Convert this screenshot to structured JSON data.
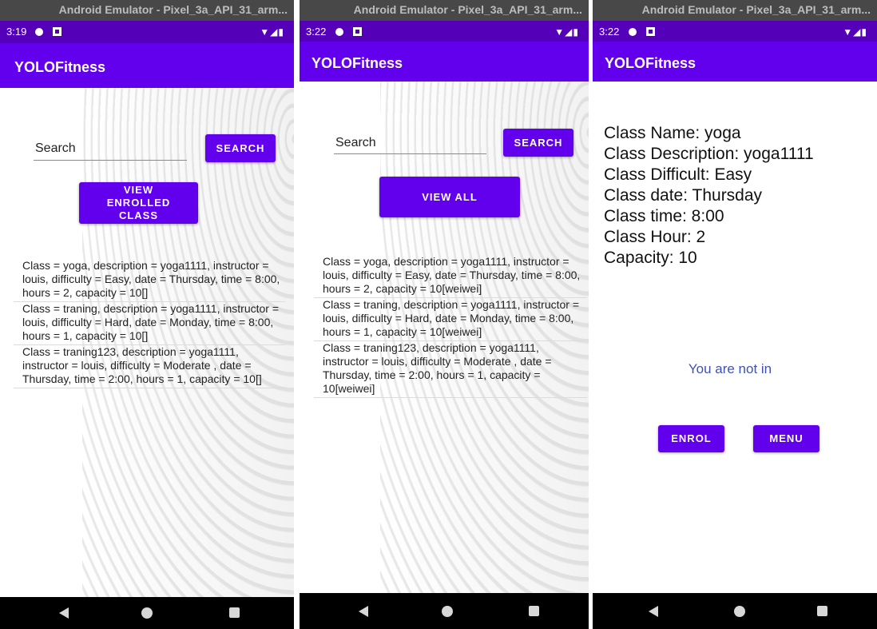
{
  "emulator_title": "Android Emulator - Pixel_3a_API_31_arm...",
  "app_title": "YOLOFitness",
  "screens": {
    "s1": {
      "time": "3:19",
      "search_text": "Search",
      "search_button": "SEARCH",
      "view_button": "VIEW ENROLLED CLASS",
      "items": [
        "Class = yoga, description = yoga1111, instructor = louis, difficulty = Easy, date = Thursday, time = 8:00, hours = 2, capacity = 10[]",
        "Class = traning, description = yoga1111, instructor = louis, difficulty = Hard, date = Monday, time = 8:00, hours = 1, capacity = 10[]",
        "Class = traning123, description = yoga1111, instructor = louis, difficulty = Moderate , date = Thursday, time = 2:00, hours = 1, capacity = 10[]"
      ]
    },
    "s2": {
      "time": "3:22",
      "search_text": "Search",
      "search_button": "SEARCH",
      "view_button": "VIEW ALL",
      "items": [
        "Class = yoga, description = yoga1111, instructor = louis, difficulty = Easy, date = Thursday, time = 8:00, hours = 2, capacity = 10[weiwei]",
        "Class = traning, description = yoga1111, instructor = louis, difficulty = Hard, date = Monday, time = 8:00, hours = 1, capacity = 10[weiwei]",
        "Class = traning123, description = yoga1111, instructor = louis, difficulty = Moderate , date = Thursday, time = 2:00, hours = 1, capacity = 10[weiwei]"
      ]
    },
    "s3": {
      "time": "3:22",
      "details": [
        "Class Name: yoga",
        "Class Description: yoga1111",
        "Class Difficult: Easy",
        "Class date: Thursday",
        "Class time: 8:00",
        "Class Hour: 2",
        "Capacity: 10"
      ],
      "notice": "You are not in",
      "enrol_button": "ENROL",
      "menu_button": "MENU"
    }
  },
  "colors": {
    "primary": "#6200ee",
    "status_bar": "#5300b8",
    "notice": "#3f51b5"
  },
  "icons": [
    "signal-wifi-icon",
    "battery-icon",
    "nav-back-icon",
    "nav-home-icon",
    "nav-recent-icon"
  ]
}
